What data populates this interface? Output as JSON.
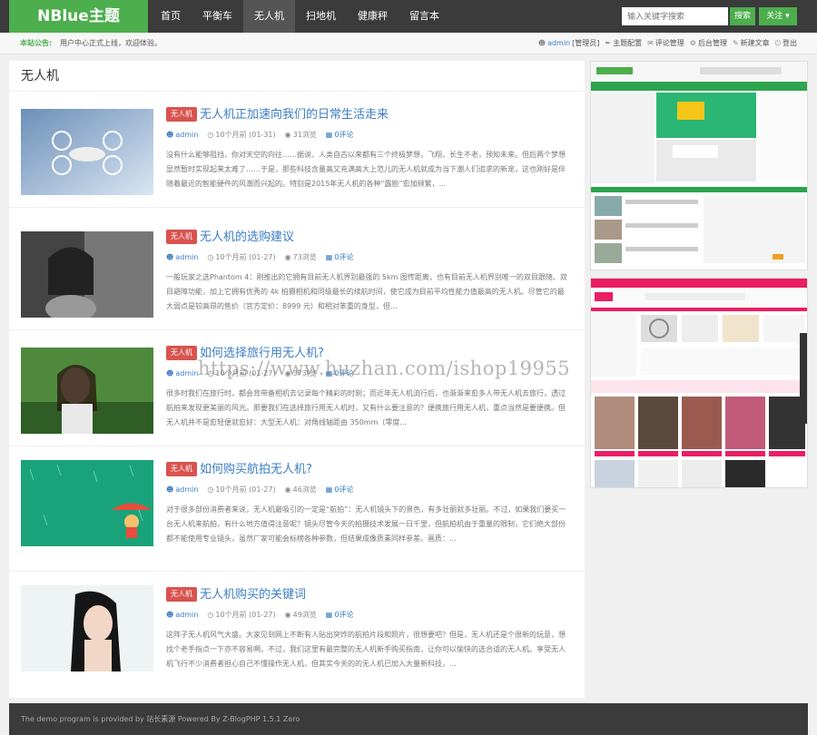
{
  "header": {
    "logo": "NBlue主题",
    "nav": [
      "首页",
      "平衡车",
      "无人机",
      "扫地机",
      "健康秤",
      "留言本"
    ],
    "active_nav": "无人机",
    "search_placeholder": "输入关键字搜索",
    "search_label": "搜索",
    "follow_label": "关注 ▾"
  },
  "notice": {
    "label": "本站公告:",
    "text": "用户中心正式上线，欢迎体验。",
    "admin_name": "admin",
    "admin_role": "[管理员]",
    "links": [
      "主题配置",
      "评论管理",
      "后台管理",
      "新建文章",
      "登出"
    ]
  },
  "category_title": "无人机",
  "posts": [
    {
      "tag": "无人机",
      "title": "无人机正加速向我们的日常生活走来",
      "author": "admin",
      "date": "10个月前 (01-31)",
      "views": "31浏览",
      "comments": "0评论",
      "excerpt": "没有什么能够阻挡，你对天空的向往……据说，人类自古以来都有三个终极梦想，飞翔，长生不老，预知未来。但后两个梦想显然暂时实现起来太难了……于是，那些科技含量高又充满高大上范儿的无人机就成为当下潮人们追求的新宠，这也刚好是伴随着最近的智能硬件的风潮而兴起的。特别是2015年无人机的各种“露脸”愈加频繁，..."
    },
    {
      "tag": "无人机",
      "title": "无人机的选购建议",
      "author": "admin",
      "date": "10个月前 (01-27)",
      "views": "73浏览",
      "comments": "0评论",
      "excerpt": "一般玩家之选Phantom 4：刚推出的它拥有目前无人机界别最强的 5km 图传距离，也有目前无人机界别唯一的双目跟随、双目避障功能，加上它拥有优秀的 4k 拍摄相机和同级最长的续航时间，使它成为目前平均性能力值最高的无人机。尽管它的最大弱点是较高昂的售价（官方定价：8999 元）和相对笨重的身型，但..."
    },
    {
      "tag": "无人机",
      "title": "如何选择旅行用无人机?",
      "author": "admin",
      "date": "10个月前 (01-27)",
      "views": "37浏览",
      "comments": "0评论",
      "excerpt": "很多时我们在旅行时，都会背带备相机去记录每个精彩的时刻；而近年无人机流行后，也渐渐来愈多人带无人机去旅行，透过航拍来发现更美丽的风光。那要我们在选择旅行用无人机时，又有什么要注意的？便携旅行用无人机，重点当然是要便携。但无人机并不是愈轻便就愈好：大型无人机：对角线轴距由 350mm（零度..."
    },
    {
      "tag": "无人机",
      "title": "如何购买航拍无人机?",
      "author": "admin",
      "date": "10个月前 (01-27)",
      "views": "46浏览",
      "comments": "0评论",
      "excerpt": "对于很多部份消费者来说，无人机最吸引的一定是“航拍”：无人机镜头下的景色，有多壮丽就多壮丽。不过，如果我们要买一台无人机来航拍，有什么地方值得注意呢？镜头尽管今天的拍摄技术发展一日千里，但航拍机由于重量的限制，它们绝大部份都不能使用专业镜头，虽然厂家可能会标榜各种参数，但结果成像质素同样参差。画质：..."
    },
    {
      "tag": "无人机",
      "title": "无人机购买的关键词",
      "author": "admin",
      "date": "10个月前 (01-27)",
      "views": "49浏览",
      "comments": "0评论",
      "excerpt": "这阵子无人机风气大盛。大家见到网上不断有人贴出突炸的航拍片段和照片，很想要吧？但是，无人机还是个很新的玩意，想找个老手指点一下亦不容易啊。不过，我们这里有最完整的无人机新手购买指南，让你可以愉快的选合适的无人机。享受无人机飞行不少消费者担心自己不懂操作无人机，但其实今天的的无人机已加入大量新科技，..."
    }
  ],
  "footer_text": "The demo program is provided by 站长素源  Powered By Z-BlogPHP 1.5.1 Zero",
  "watermark": "https://www.huzhan.com/ishop19955"
}
